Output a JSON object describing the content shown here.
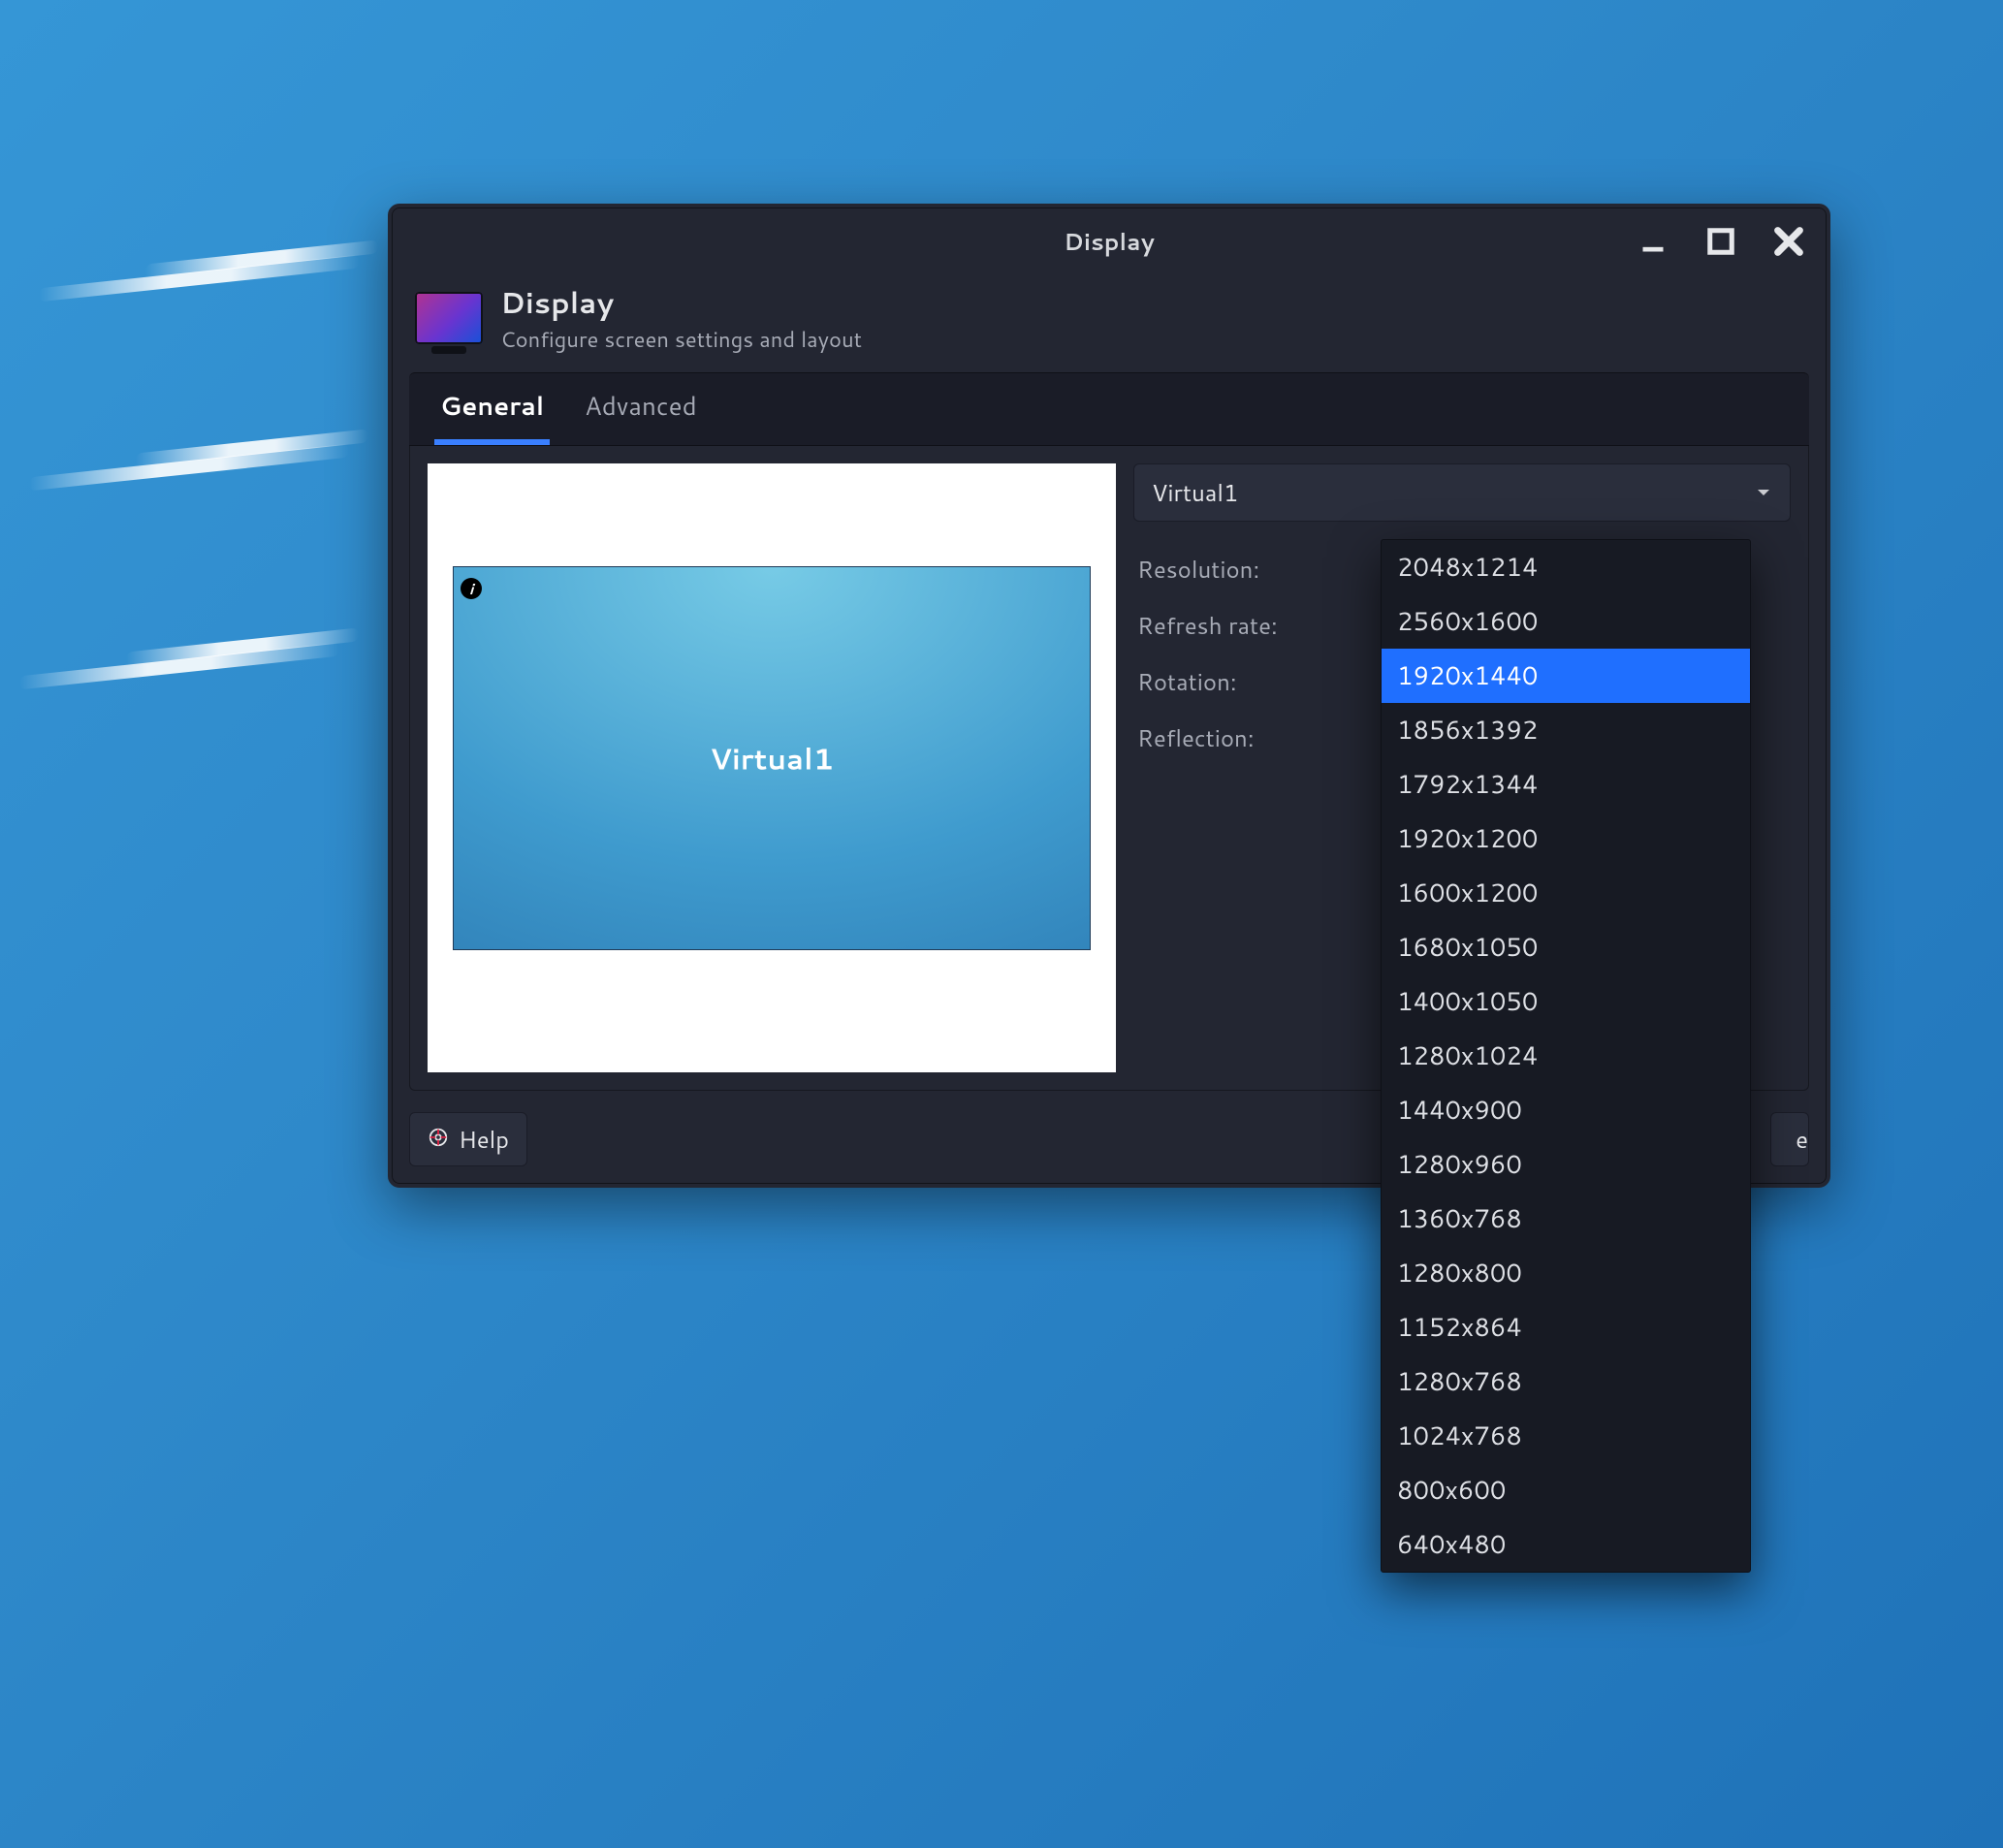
{
  "window": {
    "title": "Display"
  },
  "header": {
    "title": "Display",
    "subtitle": "Configure screen settings and layout"
  },
  "tabs": {
    "general": "General",
    "advanced": "Advanced",
    "active_index": 0
  },
  "preview": {
    "screen_label": "Virtual1"
  },
  "form": {
    "output_selected": "Virtual1",
    "labels": {
      "resolution": "Resolution:",
      "refresh": "Refresh rate:",
      "rotation": "Rotation:",
      "reflection": "Reflection:"
    }
  },
  "resolution_menu": {
    "selected_index": 2,
    "items": [
      "2048x1214",
      "2560x1600",
      "1920x1440",
      "1856x1392",
      "1792x1344",
      "1920x1200",
      "1600x1200",
      "1680x1050",
      "1400x1050",
      "1280x1024",
      "1440x900",
      "1280x960",
      "1360x768",
      "1280x800",
      "1152x864",
      "1280x768",
      "1024x768",
      "800x600",
      "640x480"
    ]
  },
  "footer": {
    "help": "Help",
    "close_suffix": "e"
  }
}
